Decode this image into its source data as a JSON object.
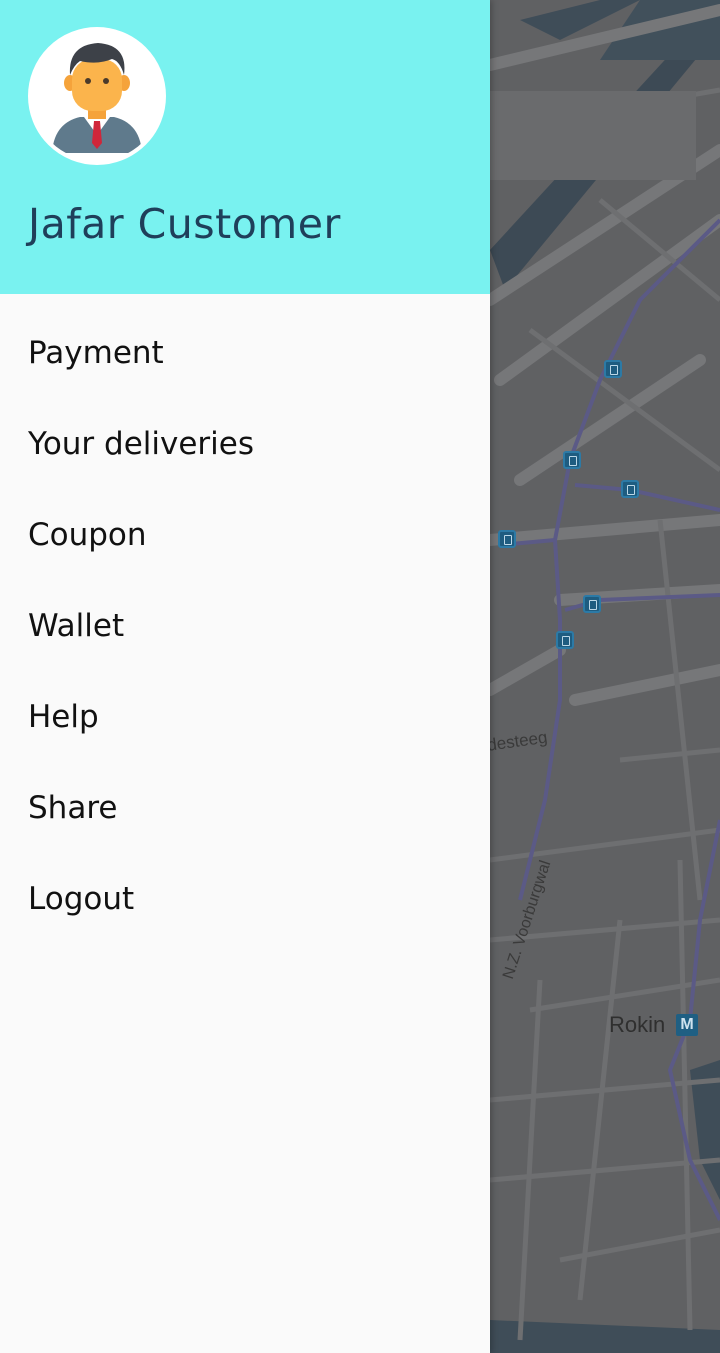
{
  "drawer": {
    "header": {
      "avatar_icon": "user-avatar-icon",
      "user_name": "Jafar Customer",
      "background_color": "#79f2f0"
    },
    "menu": [
      {
        "label": "Payment"
      },
      {
        "label": "Your deliveries"
      },
      {
        "label": "Coupon"
      },
      {
        "label": "Wallet"
      },
      {
        "label": "Help"
      },
      {
        "label": "Share"
      },
      {
        "label": "Logout"
      }
    ]
  },
  "map": {
    "labels": {
      "rokin": "Rokin",
      "street_steeg": "desteeg",
      "street_voorburgwal": "N.Z. Voorburgwal"
    },
    "metro_badge": "M"
  }
}
